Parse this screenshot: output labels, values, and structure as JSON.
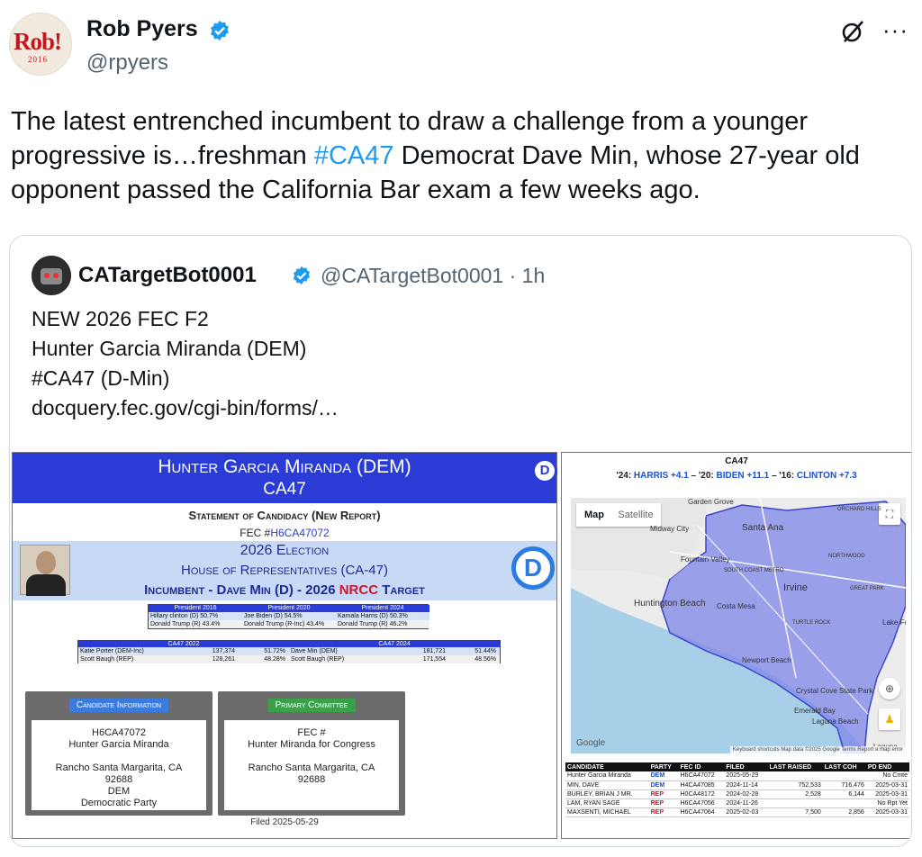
{
  "tweet": {
    "author_name": "Rob Pyers",
    "handle": "@rpyers",
    "avatar_text": "Rob!",
    "avatar_year": "2016",
    "text_before": "The latest entrenched incumbent to draw a challenge from a younger progressive is…freshman ",
    "hashtag": "#CA47",
    "text_after": " Democrat Dave Min, whose 27-year old opponent passed the California Bar exam a few weeks ago.",
    "more_label": "···"
  },
  "quote": {
    "author_name": "CATargetBot0001",
    "handle": "@CATargetBot0001",
    "time": "· 1h",
    "lines": [
      "NEW 2026 FEC F2",
      "Hunter Garcia Miranda (DEM)",
      "#CA47 (D-Min)",
      "docquery.fec.gov/cgi-bin/forms/…"
    ]
  },
  "left_image": {
    "title": "Hunter Garcia Miranda (DEM)",
    "district": "CA47",
    "dem_logo": "D",
    "statement": "Statement of Candidacy (New Report)",
    "fec_label": "FEC #",
    "fec_id": "H6CA47072",
    "election": "2026 Election",
    "office": "House of Representatives (CA-47)",
    "incumbent_prefix": "Incumbent - Dave Min (D) - 2026 ",
    "nrcc": "NRCC",
    "target": " Target",
    "pres": {
      "headers": [
        "President 2016",
        "President 2020",
        "President 2024"
      ],
      "dem": [
        "Hillary clinton (D)  50.7%",
        "Joe Biden (D)            54.5%",
        "Kamala Harris (D)  50.3%"
      ],
      "rep": [
        "Donald Trump (R)    43.4%",
        "Donald Trump (R-Inc)  43.4%",
        "Donald Trump (R)   46.2%"
      ]
    },
    "cong": {
      "headers": [
        "CA47 2022",
        "CA47 2024"
      ],
      "row1": [
        {
          "name": "Katie Porter (DEM-Inc)",
          "votes": "137,374",
          "pct": "51.72%"
        },
        {
          "name": "Dave Min (DEM)",
          "votes": "181,721",
          "pct": "51.44%"
        }
      ],
      "row2": [
        {
          "name": "Scott Baugh (REP)",
          "votes": "128,261",
          "pct": "48.28%"
        },
        {
          "name": "Scott Baugh (REP)",
          "votes": "171,554",
          "pct": "48.56%"
        }
      ]
    },
    "cand_box": {
      "label": "Candidate Information",
      "lines": [
        "H6CA47072",
        "Hunter Garcia Miranda",
        "",
        "Rancho Santa Margarita, CA",
        "92688",
        "DEM",
        "Democratic Party"
      ]
    },
    "committee_box": {
      "label": "Primary Committee",
      "lines": [
        "FEC #",
        "Hunter Miranda for Congress",
        "",
        "Rancho Santa Margarita, CA",
        "92688"
      ]
    },
    "filed": "Filed 2025-05-29"
  },
  "right_image": {
    "title": "CA47",
    "sub_24": "'24: ",
    "sub_24_val": "HARRIS +4.1",
    "sub_20": " – '20: ",
    "sub_20_val": "BIDEN +11.1",
    "sub_16": " – '16: ",
    "sub_16_val": "CLINTON +7.3",
    "map": {
      "tab_map": "Map",
      "tab_sat": "Satellite",
      "labels": [
        "Garden Grove",
        "Midway City",
        "Santa Ana",
        "Fountain Valley",
        "SOUTH COAST METRO",
        "Irvine",
        "Huntington Beach",
        "Costa Mesa",
        "Newport Beach",
        "NORTHWOOD",
        "ORCHARD HILLS",
        "TURTLE ROCK",
        "GREAT PARK",
        "Lake For",
        "Crystal Cove State Park",
        "Emerald Bay",
        "Laguna Beach",
        "Laguna"
      ],
      "google": "Google",
      "footer": "Keyboard shortcuts   Map data ©2025 Google   Terms   Report a map error"
    },
    "table": {
      "headers": [
        "CANDIDATE",
        "PARTY",
        "FEC ID",
        "FILED",
        "LAST RAISED",
        "LAST COH",
        "PD END"
      ],
      "rows": [
        [
          "Hunter Garcia Miranda",
          "DEM",
          "H6CA47072",
          "2025-05-29",
          "",
          "",
          "No Cmte"
        ],
        [
          "MIN, DAVE",
          "DEM",
          "H4CA47085",
          "2024-11-14",
          "752,533",
          "716,476",
          "2025-03-31"
        ],
        [
          "BURLEY, BRIAN J MR.",
          "REP",
          "H0CA48172",
          "2024-02-28",
          "2,528",
          "6,144",
          "2025-03-31"
        ],
        [
          "LAM, RYAN SAGE",
          "REP",
          "H6CA47056",
          "2024-11-26",
          "",
          "",
          "No Rpt Yet"
        ],
        [
          "MAXSENTI, MICHAEL",
          "REP",
          "H6CA47064",
          "2025-02-03",
          "7,500",
          "2,856",
          "2025-03-31"
        ]
      ]
    }
  }
}
